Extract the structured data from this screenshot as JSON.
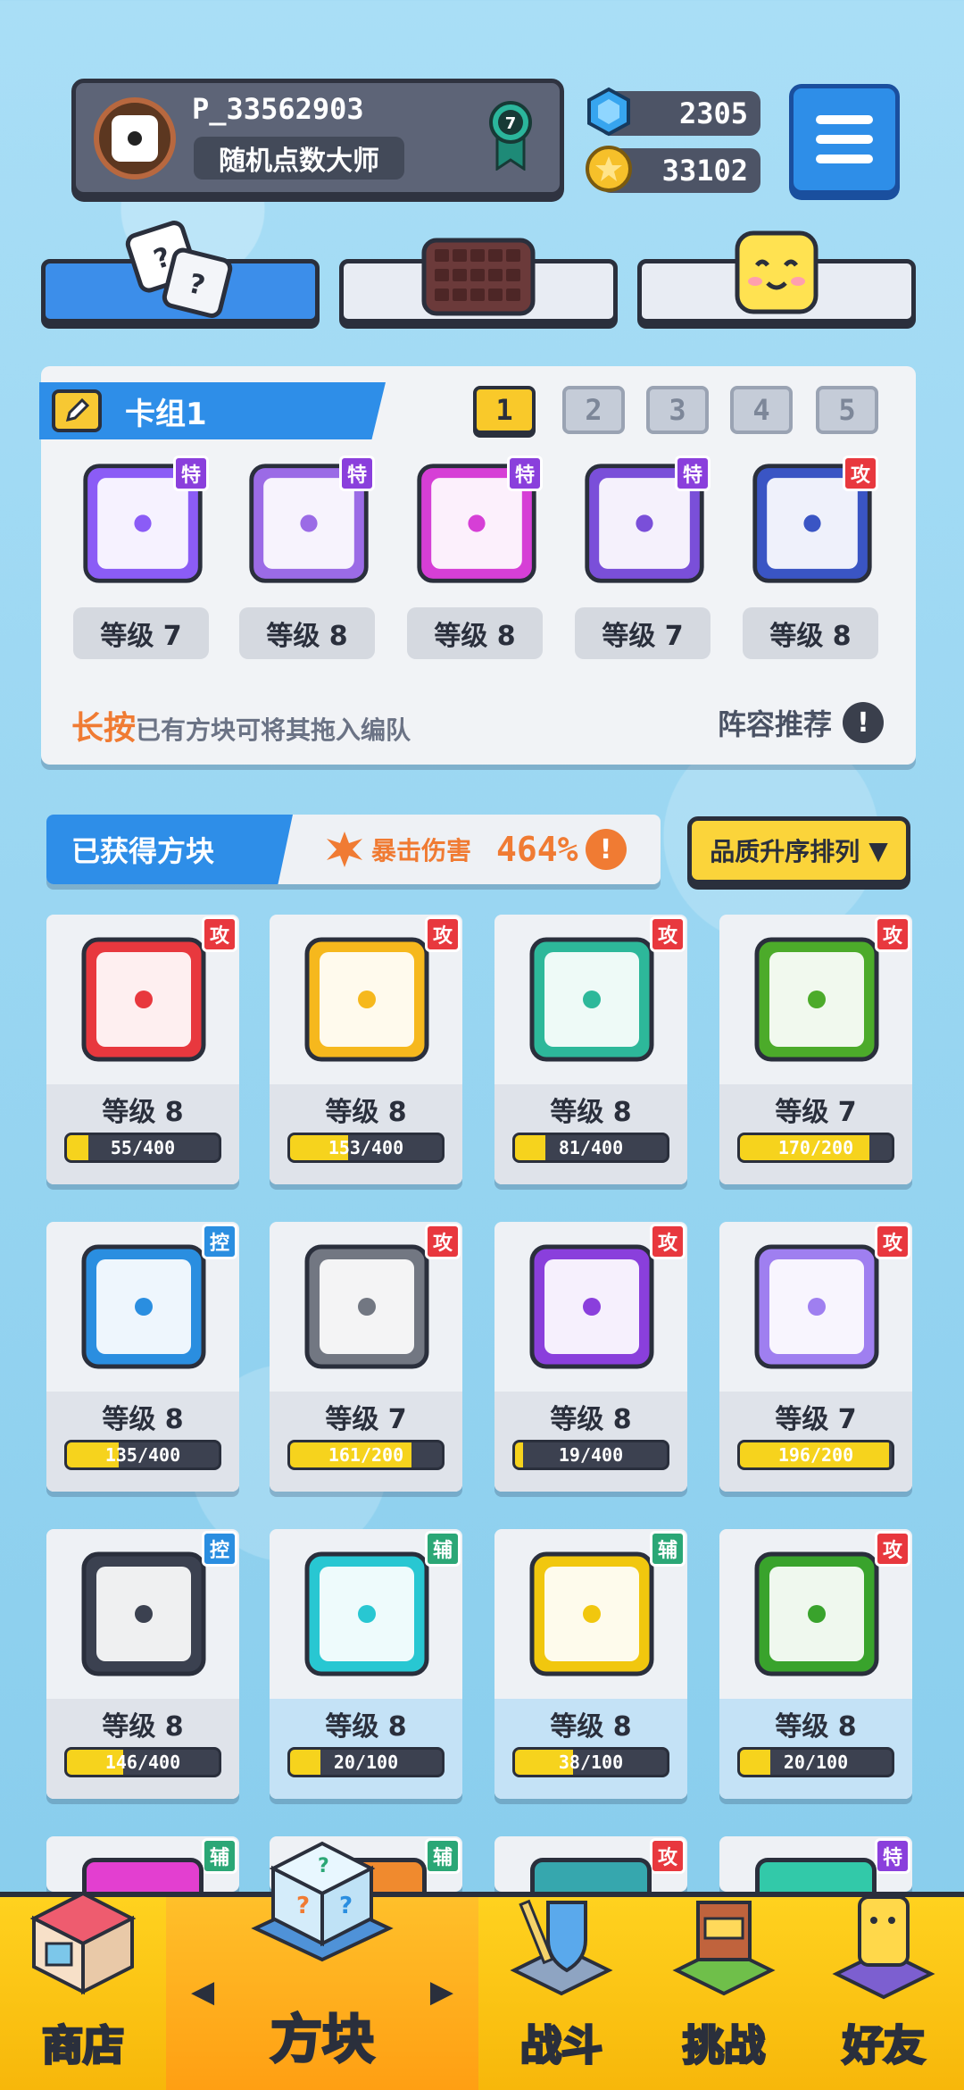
{
  "header": {
    "player_name": "P_33562903",
    "player_title": "随机点数大师",
    "rank_level": "7",
    "gems": "2305",
    "coins": "33102"
  },
  "deck": {
    "title": "卡组1",
    "slots": [
      "1",
      "2",
      "3",
      "4",
      "5"
    ],
    "active_slot": "1",
    "cards": [
      {
        "level": "等级 7",
        "tag": "特",
        "tag_type": "te",
        "color": "#8b5cf6",
        "icon": "rainbow-infinity-dice-icon"
      },
      {
        "level": "等级 8",
        "tag": "特",
        "tag_type": "te",
        "color": "#9b6be6",
        "icon": "purple-crack-dice-icon"
      },
      {
        "level": "等级 8",
        "tag": "特",
        "tag_type": "te",
        "color": "#d63fd6",
        "icon": "rainbow-dice-icon"
      },
      {
        "level": "等级 7",
        "tag": "特",
        "tag_type": "te",
        "color": "#7a4fd9",
        "icon": "dragon-purple-dice-icon"
      },
      {
        "level": "等级 8",
        "tag": "攻",
        "tag_type": "gong",
        "color": "#3a55c4",
        "icon": "gear-blue-dice-icon"
      }
    ],
    "hint_highlight": "长按",
    "hint_text": "已有方块可将其拖入编队",
    "recommend": "阵容推荐"
  },
  "acquired": {
    "title": "已获得方块",
    "crit_label": "暴击伤害",
    "crit_value": "464%",
    "sort_label": "品质升序排列"
  },
  "cards": [
    {
      "level": "等级 8",
      "progress": "55/400",
      "fill": 0.14,
      "tag": "攻",
      "tag_type": "gong",
      "color": "#e8383e",
      "icon": "fire-dice-icon"
    },
    {
      "level": "等级 8",
      "progress": "153/400",
      "fill": 0.38,
      "tag": "攻",
      "tag_type": "gong",
      "color": "#f6b81d",
      "icon": "electric-dice-icon"
    },
    {
      "level": "等级 8",
      "progress": "81/400",
      "fill": 0.2,
      "tag": "攻",
      "tag_type": "gong",
      "color": "#2db89a",
      "icon": "wind-dice-icon"
    },
    {
      "level": "等级 7",
      "progress": "170/200",
      "fill": 0.85,
      "tag": "攻",
      "tag_type": "gong",
      "color": "#4cab2a",
      "icon": "poison-dice-icon"
    },
    {
      "level": "等级 8",
      "progress": "135/400",
      "fill": 0.34,
      "tag": "控",
      "tag_type": "kong",
      "color": "#2a8ee0",
      "icon": "ice-dice-icon"
    },
    {
      "level": "等级 7",
      "progress": "161/200",
      "fill": 0.8,
      "tag": "攻",
      "tag_type": "gong",
      "color": "#727782",
      "icon": "iron-dice-icon"
    },
    {
      "level": "等级 8",
      "progress": "19/400",
      "fill": 0.05,
      "tag": "攻",
      "tag_type": "gong",
      "color": "#8a3fdc",
      "icon": "arrow-dice-icon"
    },
    {
      "level": "等级 7",
      "progress": "196/200",
      "fill": 0.98,
      "tag": "攻",
      "tag_type": "gong",
      "color": "#9f7ff0",
      "icon": "mystery-dice-icon"
    },
    {
      "level": "等级 8",
      "progress": "146/400",
      "fill": 0.37,
      "tag": "控",
      "tag_type": "kong",
      "color": "#3b4150",
      "icon": "lock-dice-icon"
    },
    {
      "level": "等级 8",
      "progress": "20/100",
      "fill": 0.2,
      "tag": "辅",
      "tag_type": "fu",
      "color": "#28c7d2",
      "icon": "heal-dice-icon",
      "blue": true
    },
    {
      "level": "等级 8",
      "progress": "38/100",
      "fill": 0.38,
      "tag": "辅",
      "tag_type": "fu",
      "color": "#f1c70e",
      "icon": "buff-dice-icon",
      "blue": true
    },
    {
      "level": "等级 8",
      "progress": "20/100",
      "fill": 0.2,
      "tag": "攻",
      "tag_type": "gong",
      "color": "#39a32c",
      "icon": "thorn-dice-icon",
      "blue": true
    }
  ],
  "partial_cards": [
    {
      "tag": "辅",
      "tag_type": "fu",
      "color": "#e33fd0"
    },
    {
      "tag": "辅",
      "tag_type": "fu",
      "color": "#f08a2e"
    },
    {
      "tag": "攻",
      "tag_type": "gong",
      "color": "#36a7ae"
    },
    {
      "tag": "特",
      "tag_type": "te",
      "color": "#32c9a9"
    }
  ],
  "nav": {
    "shop": "商店",
    "dice": "方块",
    "battle": "战斗",
    "challenge": "挑战",
    "friends": "好友"
  }
}
